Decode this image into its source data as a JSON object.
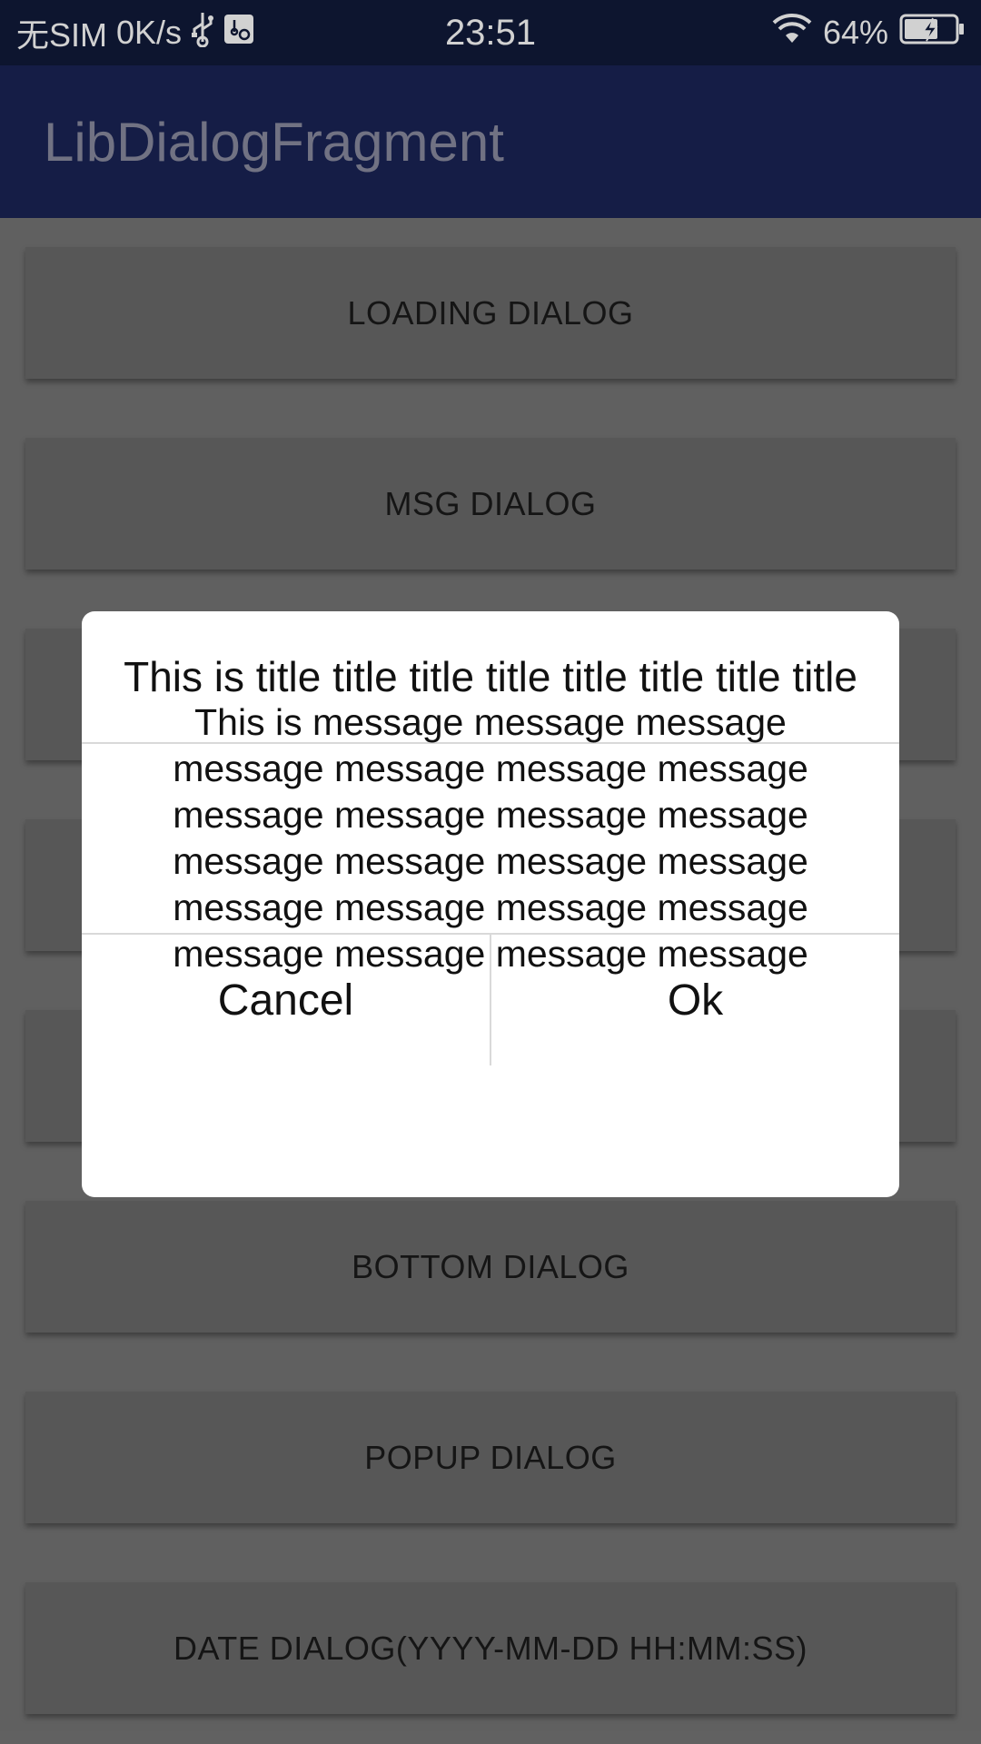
{
  "status_bar": {
    "carrier": "无SIM",
    "speed": "0K/s",
    "time": "23:51",
    "battery": "64%"
  },
  "app_bar": {
    "title": "LibDialogFragment"
  },
  "buttons": [
    "LOADING DIALOG",
    "MSG DIALOG",
    "",
    "",
    "",
    "BOTTOM DIALOG",
    "POPUP DIALOG",
    "DATE DIALOG(YYYY-MM-DD HH:MM:SS)"
  ],
  "dialog": {
    "title": "This is title title title title title title title title",
    "message": "This is message message message message message message message message message message message message message message message message message message message message message message message",
    "cancel_label": "Cancel",
    "ok_label": "Ok"
  },
  "colors": {
    "status_bar": "#111a3a",
    "app_bar": "#1a2456",
    "dialog_bg": "#ffffff"
  }
}
